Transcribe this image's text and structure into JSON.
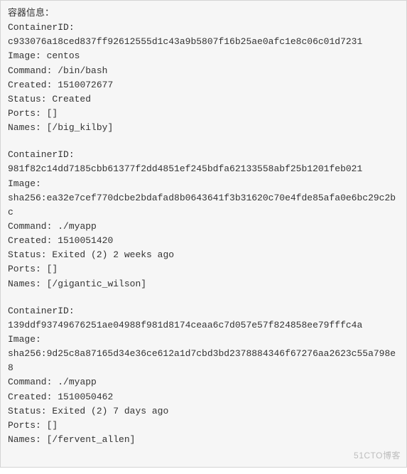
{
  "header": "容器信息：",
  "labels": {
    "container_id": "ContainerID:",
    "image": "Image:",
    "command": "Command:",
    "created": "Created:",
    "status": "Status:",
    "ports": "Ports:",
    "names": "Names:"
  },
  "containers": [
    {
      "id": "c933076a18ced837ff92612555d1c43a9b5807f16b25ae0afc1e8c06c01d7231",
      "image": "centos",
      "command": "/bin/bash",
      "created": "1510072677",
      "status": "Created",
      "ports": "[]",
      "names": "[/big_kilby]"
    },
    {
      "id": "981f82c14dd7185cbb61377f2dd4851ef245bdfa62133558abf25b1201feb021",
      "image": "sha256:ea32e7cef770dcbe2bdafad8b0643641f3b31620c70e4fde85afa0e6bc29c2bc",
      "command": "./myapp",
      "created": "1510051420",
      "status": "Exited (2) 2 weeks ago",
      "ports": "[]",
      "names": "[/gigantic_wilson]"
    },
    {
      "id": "139ddf93749676251ae04988f981d8174ceaa6c7d057e57f824858ee79fffc4a",
      "image": "sha256:9d25c8a87165d34e36ce612a1d7cbd3bd2378884346f67276aa2623c55a798e8",
      "command": "./myapp",
      "created": "1510050462",
      "status": "Exited (2) 7 days ago",
      "ports": "[]",
      "names": "[/fervent_allen]"
    }
  ],
  "watermark": "51CTO博客"
}
